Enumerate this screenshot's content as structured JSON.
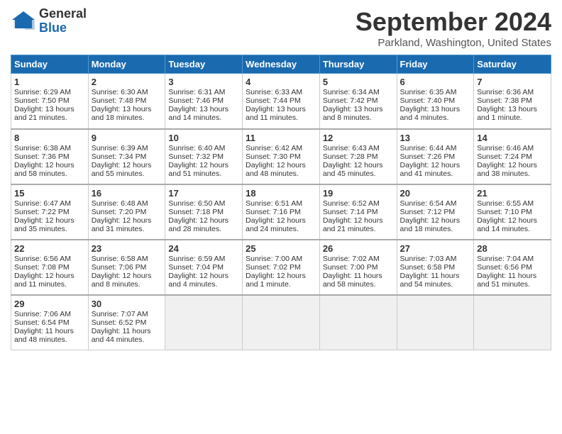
{
  "logo": {
    "general": "General",
    "blue": "Blue"
  },
  "title": "September 2024",
  "location": "Parkland, Washington, United States",
  "days_of_week": [
    "Sunday",
    "Monday",
    "Tuesday",
    "Wednesday",
    "Thursday",
    "Friday",
    "Saturday"
  ],
  "weeks": [
    [
      {
        "day": "1",
        "sunrise": "6:29 AM",
        "sunset": "7:50 PM",
        "daylight": "13 hours and 21 minutes."
      },
      {
        "day": "2",
        "sunrise": "6:30 AM",
        "sunset": "7:48 PM",
        "daylight": "13 hours and 18 minutes."
      },
      {
        "day": "3",
        "sunrise": "6:31 AM",
        "sunset": "7:46 PM",
        "daylight": "13 hours and 14 minutes."
      },
      {
        "day": "4",
        "sunrise": "6:33 AM",
        "sunset": "7:44 PM",
        "daylight": "13 hours and 11 minutes."
      },
      {
        "day": "5",
        "sunrise": "6:34 AM",
        "sunset": "7:42 PM",
        "daylight": "13 hours and 8 minutes."
      },
      {
        "day": "6",
        "sunrise": "6:35 AM",
        "sunset": "7:40 PM",
        "daylight": "13 hours and 4 minutes."
      },
      {
        "day": "7",
        "sunrise": "6:36 AM",
        "sunset": "7:38 PM",
        "daylight": "13 hours and 1 minute."
      }
    ],
    [
      {
        "day": "8",
        "sunrise": "6:38 AM",
        "sunset": "7:36 PM",
        "daylight": "12 hours and 58 minutes."
      },
      {
        "day": "9",
        "sunrise": "6:39 AM",
        "sunset": "7:34 PM",
        "daylight": "12 hours and 55 minutes."
      },
      {
        "day": "10",
        "sunrise": "6:40 AM",
        "sunset": "7:32 PM",
        "daylight": "12 hours and 51 minutes."
      },
      {
        "day": "11",
        "sunrise": "6:42 AM",
        "sunset": "7:30 PM",
        "daylight": "12 hours and 48 minutes."
      },
      {
        "day": "12",
        "sunrise": "6:43 AM",
        "sunset": "7:28 PM",
        "daylight": "12 hours and 45 minutes."
      },
      {
        "day": "13",
        "sunrise": "6:44 AM",
        "sunset": "7:26 PM",
        "daylight": "12 hours and 41 minutes."
      },
      {
        "day": "14",
        "sunrise": "6:46 AM",
        "sunset": "7:24 PM",
        "daylight": "12 hours and 38 minutes."
      }
    ],
    [
      {
        "day": "15",
        "sunrise": "6:47 AM",
        "sunset": "7:22 PM",
        "daylight": "12 hours and 35 minutes."
      },
      {
        "day": "16",
        "sunrise": "6:48 AM",
        "sunset": "7:20 PM",
        "daylight": "12 hours and 31 minutes."
      },
      {
        "day": "17",
        "sunrise": "6:50 AM",
        "sunset": "7:18 PM",
        "daylight": "12 hours and 28 minutes."
      },
      {
        "day": "18",
        "sunrise": "6:51 AM",
        "sunset": "7:16 PM",
        "daylight": "12 hours and 24 minutes."
      },
      {
        "day": "19",
        "sunrise": "6:52 AM",
        "sunset": "7:14 PM",
        "daylight": "12 hours and 21 minutes."
      },
      {
        "day": "20",
        "sunrise": "6:54 AM",
        "sunset": "7:12 PM",
        "daylight": "12 hours and 18 minutes."
      },
      {
        "day": "21",
        "sunrise": "6:55 AM",
        "sunset": "7:10 PM",
        "daylight": "12 hours and 14 minutes."
      }
    ],
    [
      {
        "day": "22",
        "sunrise": "6:56 AM",
        "sunset": "7:08 PM",
        "daylight": "12 hours and 11 minutes."
      },
      {
        "day": "23",
        "sunrise": "6:58 AM",
        "sunset": "7:06 PM",
        "daylight": "12 hours and 8 minutes."
      },
      {
        "day": "24",
        "sunrise": "6:59 AM",
        "sunset": "7:04 PM",
        "daylight": "12 hours and 4 minutes."
      },
      {
        "day": "25",
        "sunrise": "7:00 AM",
        "sunset": "7:02 PM",
        "daylight": "12 hours and 1 minute."
      },
      {
        "day": "26",
        "sunrise": "7:02 AM",
        "sunset": "7:00 PM",
        "daylight": "11 hours and 58 minutes."
      },
      {
        "day": "27",
        "sunrise": "7:03 AM",
        "sunset": "6:58 PM",
        "daylight": "11 hours and 54 minutes."
      },
      {
        "day": "28",
        "sunrise": "7:04 AM",
        "sunset": "6:56 PM",
        "daylight": "11 hours and 51 minutes."
      }
    ],
    [
      {
        "day": "29",
        "sunrise": "7:06 AM",
        "sunset": "6:54 PM",
        "daylight": "11 hours and 48 minutes."
      },
      {
        "day": "30",
        "sunrise": "7:07 AM",
        "sunset": "6:52 PM",
        "daylight": "11 hours and 44 minutes."
      },
      {
        "day": "",
        "sunrise": "",
        "sunset": "",
        "daylight": ""
      },
      {
        "day": "",
        "sunrise": "",
        "sunset": "",
        "daylight": ""
      },
      {
        "day": "",
        "sunrise": "",
        "sunset": "",
        "daylight": ""
      },
      {
        "day": "",
        "sunrise": "",
        "sunset": "",
        "daylight": ""
      },
      {
        "day": "",
        "sunrise": "",
        "sunset": "",
        "daylight": ""
      }
    ]
  ]
}
